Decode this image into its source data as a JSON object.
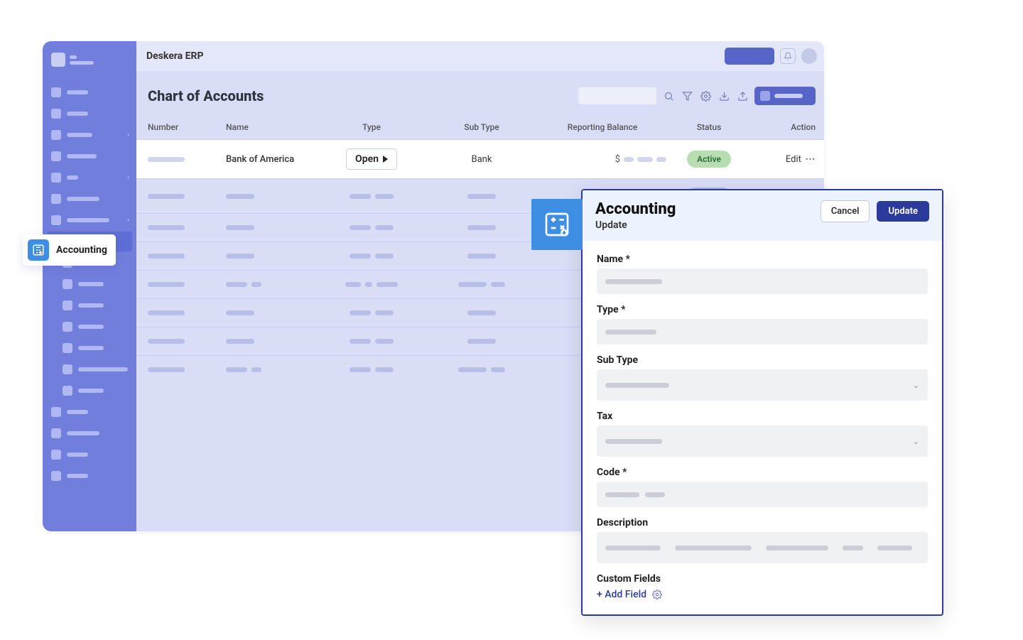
{
  "topbar": {
    "title": "Deskera ERP"
  },
  "page": {
    "title": "Chart of Accounts"
  },
  "table": {
    "headers": {
      "number": "Number",
      "name": "Name",
      "type": "Type",
      "sub": "Sub Type",
      "bal": "Reporting Balance",
      "status": "Status",
      "action": "Action"
    },
    "row1": {
      "name": "Bank of America",
      "open": "Open",
      "sub": "Bank",
      "currency": "$",
      "status": "Active",
      "action": "Edit"
    }
  },
  "sidebar_tab": {
    "label": "Accounting"
  },
  "modal": {
    "title": "Accounting",
    "subtitle": "Update",
    "cancel": "Cancel",
    "update": "Update",
    "fields": {
      "name": "Name *",
      "type": "Type *",
      "subtype": "Sub Type",
      "tax": "Tax",
      "code": "Code *",
      "description": "Description",
      "custom": "Custom Fields",
      "add": "+ Add Field"
    }
  }
}
